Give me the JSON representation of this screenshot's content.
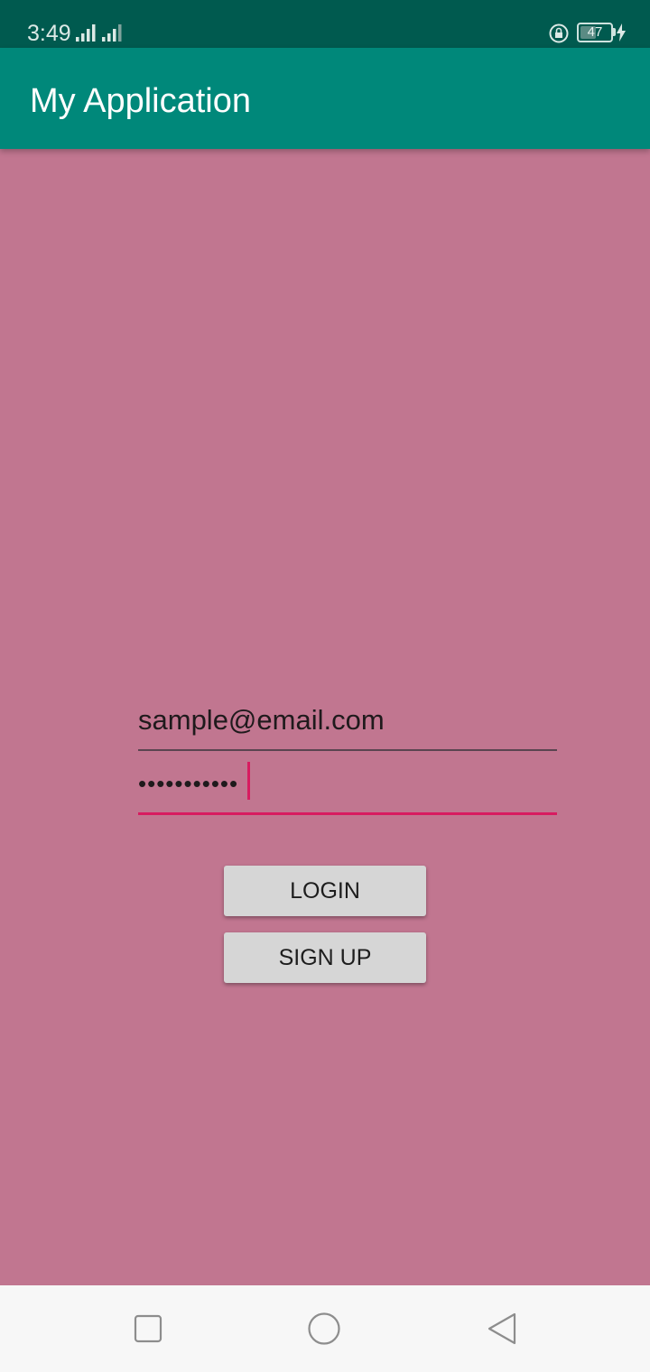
{
  "status_bar": {
    "time": "3:49",
    "battery_level": "47",
    "icons": [
      "signal-icon",
      "signal-icon",
      "rotation-lock-icon",
      "battery-icon",
      "charging-icon"
    ]
  },
  "app_bar": {
    "title": "My Application"
  },
  "form": {
    "email_value": "sample@email.com",
    "password_value": "•••••••••••"
  },
  "buttons": {
    "login_label": "LOGIN",
    "signup_label": "SIGN UP"
  },
  "nav_bar": {
    "icons": [
      "recents-icon",
      "home-icon",
      "back-icon"
    ]
  },
  "colors": {
    "status_bar": "#005a4f",
    "app_bar": "#00887a",
    "background": "#c17690",
    "accent": "#d81b60",
    "button": "#d6d6d6"
  }
}
